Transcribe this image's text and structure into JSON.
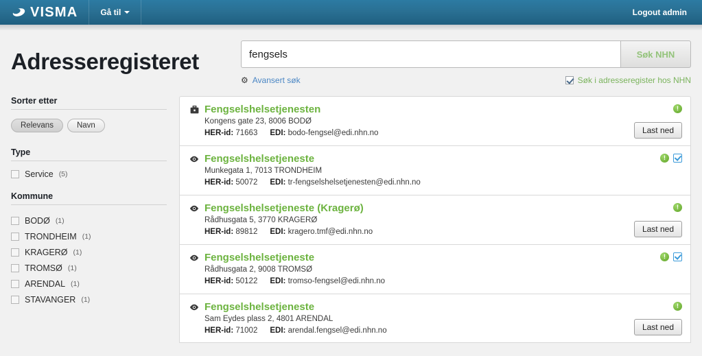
{
  "topbar": {
    "brand": "VISMA",
    "brand_icon": "visma-swoosh-icon",
    "goto_label": "Gå til",
    "logout_label": "Logout admin"
  },
  "header": {
    "page_title": "Adresseregisteret"
  },
  "search": {
    "value": "fengsels",
    "placeholder": "",
    "button_label": "Søk NHN",
    "advanced_label": "Avansert søk",
    "nhn_checkbox_label": "Søk i adresseregister hos NHN",
    "nhn_checkbox_checked": true
  },
  "sidebar": {
    "sort_title": "Sorter etter",
    "sort_options": [
      {
        "label": "Relevans",
        "active": true
      },
      {
        "label": "Navn",
        "active": false
      }
    ],
    "type_title": "Type",
    "type_items": [
      {
        "label": "Service",
        "count": "(5)",
        "checked": false
      }
    ],
    "kommune_title": "Kommune",
    "kommune_items": [
      {
        "label": "BODØ",
        "count": "(1)",
        "checked": false
      },
      {
        "label": "TRONDHEIM",
        "count": "(1)",
        "checked": false
      },
      {
        "label": "KRAGERØ",
        "count": "(1)",
        "checked": false
      },
      {
        "label": "TROMSØ",
        "count": "(1)",
        "checked": false
      },
      {
        "label": "ARENDAL",
        "count": "(1)",
        "checked": false
      },
      {
        "label": "STAVANGER",
        "count": "(1)",
        "checked": false
      }
    ]
  },
  "results": {
    "her_label": "HER-id:",
    "edi_label": "EDI:",
    "download_label": "Last ned",
    "items": [
      {
        "icon": "briefcase-icon",
        "title": "Fengselshelsetjenesten",
        "address": "Kongens gate 23, 8006 BODØ",
        "her_id": "71663",
        "edi": "bodo-fengsel@edi.nhn.no",
        "badge_warn": true,
        "badge_check": false,
        "download": true
      },
      {
        "icon": "eye-icon",
        "title": "Fengselshelsetjeneste",
        "address": "Munkegata 1, 7013 TRONDHEIM",
        "her_id": "50072",
        "edi": "tr-fengselshelsetjenesten@edi.nhn.no",
        "badge_warn": true,
        "badge_check": true,
        "download": false
      },
      {
        "icon": "eye-icon",
        "title": "Fengselshelsetjeneste (Kragerø)",
        "address": "Rådhusgata 5, 3770 KRAGERØ",
        "her_id": "89812",
        "edi": "kragero.tmf@edi.nhn.no",
        "badge_warn": true,
        "badge_check": false,
        "download": true
      },
      {
        "icon": "eye-icon",
        "title": "Fengselshelsetjeneste",
        "address": "Rådhusgata 2, 9008 TROMSØ",
        "her_id": "50122",
        "edi": "tromso-fengsel@edi.nhn.no",
        "badge_warn": true,
        "badge_check": true,
        "download": false
      },
      {
        "icon": "eye-icon",
        "title": "Fengselshelsetjeneste",
        "address": "Sam Eydes plass 2, 4801 ARENDAL",
        "her_id": "71002",
        "edi": "arendal.fengsel@edi.nhn.no",
        "badge_warn": true,
        "badge_check": false,
        "download": true
      }
    ]
  },
  "icons": {
    "gear": "⚙",
    "warn_char": "!"
  }
}
